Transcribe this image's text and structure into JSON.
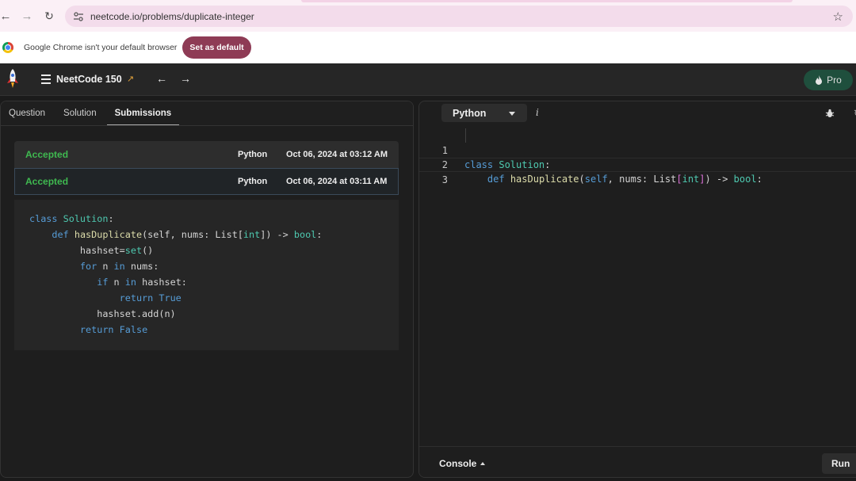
{
  "browser": {
    "url": "neetcode.io/problems/duplicate-integer",
    "back_icon": "arrow-left",
    "forward_icon": "arrow-right",
    "reload_icon": "reload",
    "star_icon": "star"
  },
  "infobar": {
    "message": "Google Chrome isn't your default browser",
    "button_label": "Set as default"
  },
  "header": {
    "list_title": "NeetCode 150",
    "pro_label": "Pro"
  },
  "left_panel": {
    "tabs": [
      "Question",
      "Solution",
      "Submissions"
    ],
    "active_tab": "Submissions",
    "submissions": [
      {
        "status": "Accepted",
        "language": "Python",
        "date": "Oct 06, 2024 at 03:12 AM"
      },
      {
        "status": "Accepted",
        "language": "Python",
        "date": "Oct 06, 2024 at 03:11 AM"
      }
    ],
    "code_lines": [
      "class Solution:",
      "    def hasDuplicate(self, nums: List[int]) -> bool:",
      "        hashset=set()",
      "        for n in nums:",
      "           if n in hashset:",
      "               return True",
      "           hashset.add(n)",
      "        return False"
    ]
  },
  "editor": {
    "language": "Python",
    "info_label": "i",
    "line_numbers": [
      "1",
      "2",
      "3"
    ],
    "lines": [
      "class Solution:",
      "    def hasDuplicate(self, nums: List[int]) -> bool:",
      ""
    ],
    "console_label": "Console",
    "run_label": "Run"
  }
}
